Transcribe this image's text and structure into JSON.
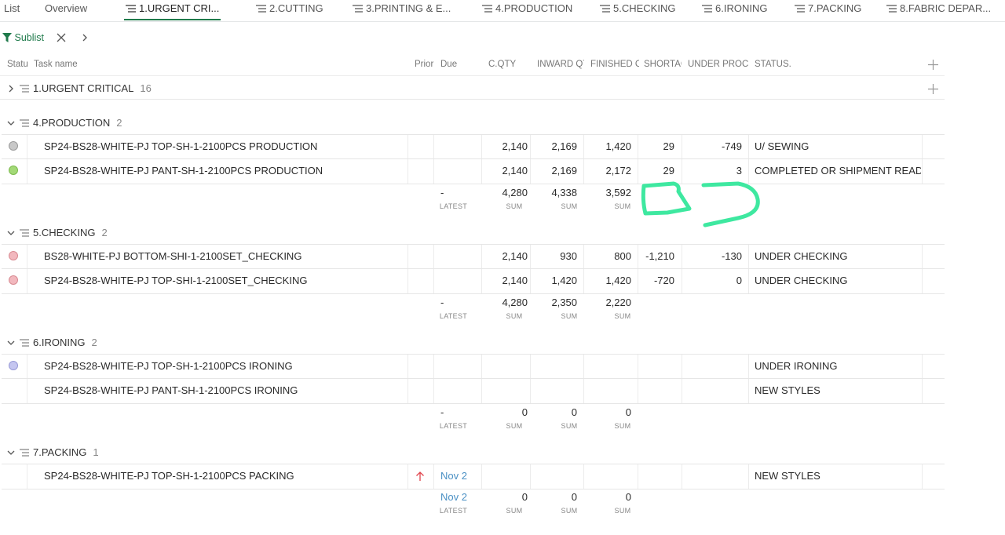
{
  "tabs": [
    {
      "label": "List",
      "icon": "none"
    },
    {
      "label": "Overview",
      "icon": "none"
    },
    {
      "label": "1.URGENT CRI...",
      "icon": "list-icon",
      "active": true
    },
    {
      "label": "2.CUTTING",
      "icon": "list-icon"
    },
    {
      "label": "3.PRINTING & E...",
      "icon": "list-icon"
    },
    {
      "label": "4.PRODUCTION",
      "icon": "list-icon"
    },
    {
      "label": "5.CHECKING",
      "icon": "list-icon"
    },
    {
      "label": "6.IRONING",
      "icon": "list-icon"
    },
    {
      "label": "7.PACKING",
      "icon": "list-icon"
    },
    {
      "label": "8.FABRIC DEPAR...",
      "icon": "list-icon"
    }
  ],
  "filter": {
    "label": "Sublist"
  },
  "columns": {
    "status": "Statu",
    "task": "Task name",
    "priority": "Prior",
    "due": "Due",
    "cqty": "C.QTY",
    "inward": "INWARD QT",
    "finished": "FINISHED C",
    "shortage": "SHORTAG",
    "under": "UNDER PROCE",
    "statuscol": "STATUS."
  },
  "groups": [
    {
      "name": "1.URGENT CRITICAL",
      "count": "16",
      "collapsed": true
    },
    {
      "name": "4.PRODUCTION",
      "count": "2",
      "rows": [
        {
          "status": "grey",
          "task": "SP24-BS28-WHITE-PJ TOP-SH-1-2100PCS PRODUCTION",
          "cqty": "2,140",
          "inward": "2,169",
          "finished": "1,420",
          "shortage": "29",
          "under": "-749",
          "stat": "U/ SEWING"
        },
        {
          "status": "green",
          "task": "SP24-BS28-WHITE-PJ PANT-SH-1-2100PCS PRODUCTION",
          "cqty": "2,140",
          "inward": "2,169",
          "finished": "2,172",
          "shortage": "29",
          "under": "3",
          "stat": "COMPLETED OR SHIPMENT READ"
        }
      ],
      "summary": {
        "due": "-",
        "due_label": "LATEST",
        "cqty": "4,280",
        "inward": "4,338",
        "finished": "3,592",
        "agg": "SUM"
      }
    },
    {
      "name": "5.CHECKING",
      "count": "2",
      "rows": [
        {
          "status": "red",
          "task": "BS28-WHITE-PJ BOTTOM-SHI-1-2100SET_CHECKING",
          "cqty": "2,140",
          "inward": "930",
          "finished": "800",
          "shortage": "-1,210",
          "under": "-130",
          "stat": "UNDER CHECKING"
        },
        {
          "status": "red",
          "task": "SP24-BS28-WHITE-PJ TOP-SHI-1-2100SET_CHECKING",
          "cqty": "2,140",
          "inward": "1,420",
          "finished": "1,420",
          "shortage": "-720",
          "under": "0",
          "stat": "UNDER CHECKING"
        }
      ],
      "summary": {
        "due": "-",
        "due_label": "LATEST",
        "cqty": "4,280",
        "inward": "2,350",
        "finished": "2,220",
        "agg": "SUM"
      }
    },
    {
      "name": "6.IRONING",
      "count": "2",
      "rows": [
        {
          "status": "blue",
          "task": "SP24-BS28-WHITE-PJ TOP-SH-1-2100PCS IRONING",
          "cqty": "",
          "inward": "",
          "finished": "",
          "shortage": "",
          "under": "",
          "stat": "UNDER IRONING"
        },
        {
          "status": "none",
          "task": "SP24-BS28-WHITE-PJ PANT-SH-1-2100PCS IRONING",
          "cqty": "",
          "inward": "",
          "finished": "",
          "shortage": "",
          "under": "",
          "stat": "NEW STYLES"
        }
      ],
      "summary": {
        "due": "-",
        "due_label": "LATEST",
        "cqty": "0",
        "inward": "0",
        "finished": "0",
        "agg": "SUM"
      }
    },
    {
      "name": "7.PACKING",
      "count": "1",
      "rows": [
        {
          "status": "none",
          "priority": "up-arrow",
          "task": "SP24-BS28-WHITE-PJ TOP-SH-1-2100PCS PACKING",
          "due": "Nov 2",
          "cqty": "",
          "inward": "",
          "finished": "",
          "shortage": "",
          "under": "",
          "stat": "NEW STYLES"
        }
      ],
      "summary": {
        "due": "Nov 2",
        "due_label": "LATEST",
        "cqty": "0",
        "inward": "0",
        "finished": "0",
        "agg": "SUM"
      }
    }
  ],
  "colors": {
    "accent": "#1f7a4b",
    "annotation": "#3ee8a0",
    "grey": "#c8c8c8",
    "green": "#a3d977",
    "red": "#f2b8be",
    "blue": "#c5c6f0",
    "link": "#4a90c4",
    "priority": "#e0444c"
  }
}
